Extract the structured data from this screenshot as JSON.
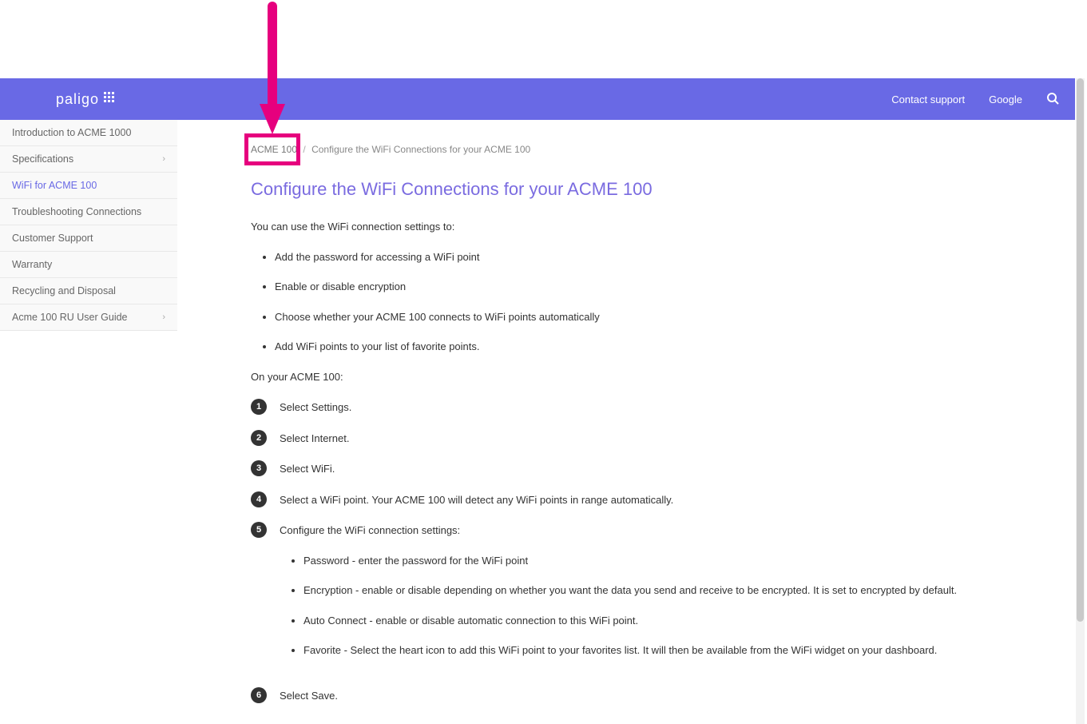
{
  "header": {
    "logo_text": "paligo",
    "links": [
      "Contact support",
      "Google"
    ]
  },
  "sidebar": {
    "items": [
      {
        "label": "Introduction to ACME 1000",
        "active": false,
        "expandable": false
      },
      {
        "label": "Specifications",
        "active": false,
        "expandable": true
      },
      {
        "label": "WiFi for ACME 100",
        "active": true,
        "expandable": false
      },
      {
        "label": "Troubleshooting Connections",
        "active": false,
        "expandable": false
      },
      {
        "label": "Customer Support",
        "active": false,
        "expandable": false
      },
      {
        "label": "Warranty",
        "active": false,
        "expandable": false
      },
      {
        "label": "Recycling and Disposal",
        "active": false,
        "expandable": false
      },
      {
        "label": "Acme 100 RU User Guide",
        "active": false,
        "expandable": true
      }
    ]
  },
  "breadcrumb": {
    "root": "ACME 100",
    "current": "Configure the WiFi Connections for your ACME 100"
  },
  "content": {
    "title": "Configure the WiFi Connections for your ACME 100",
    "intro": "You can use the WiFi connection settings to:",
    "bullets1": [
      "Add the password for accessing a WiFi point",
      "Enable or disable encryption",
      "Choose whether your ACME 100 connects to WiFi points automatically",
      "Add WiFi points to your list of favorite points."
    ],
    "para2": "On your ACME 100:",
    "steps": [
      "Select Settings.",
      "Select Internet.",
      "Select WiFi.",
      "Select a WiFi point. Your ACME 100 will detect any WiFi points in range automatically.",
      "Configure the WiFi connection settings:",
      "Select Save."
    ],
    "step5_bullets": [
      "Password - enter the password for the WiFi point",
      "Encryption - enable or disable depending on whether you want the data you send and receive to be encrypted. It is set to encrypted by default.",
      "Auto Connect - enable or disable automatic connection to this WiFi point.",
      "Favorite - Select the heart icon to add this WiFi point to your favorites list. It will then be available from the WiFi widget on your dashboard."
    ]
  },
  "annotation": {
    "highlight_color": "#e6007e"
  }
}
